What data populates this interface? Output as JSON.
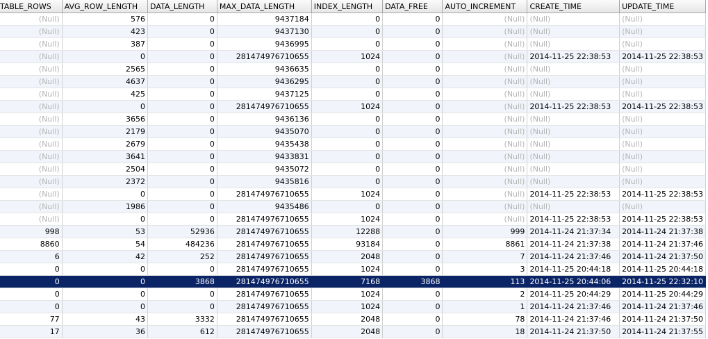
{
  "columns": [
    "TABLE_ROWS",
    "AVG_ROW_LENGTH",
    "DATA_LENGTH",
    "MAX_DATA_LENGTH",
    "INDEX_LENGTH",
    "DATA_FREE",
    "AUTO_INCREMENT",
    "CREATE_TIME",
    "UPDATE_TIME"
  ],
  "selected_row": 21,
  "rows": [
    [
      "(Null)",
      "576",
      "0",
      "9437184",
      "0",
      "0",
      "(Null)",
      "(Null)",
      "(Null)"
    ],
    [
      "(Null)",
      "423",
      "0",
      "9437130",
      "0",
      "0",
      "(Null)",
      "(Null)",
      "(Null)"
    ],
    [
      "(Null)",
      "387",
      "0",
      "9436995",
      "0",
      "0",
      "(Null)",
      "(Null)",
      "(Null)"
    ],
    [
      "(Null)",
      "0",
      "0",
      "281474976710655",
      "1024",
      "0",
      "(Null)",
      "2014-11-25 22:38:53",
      "2014-11-25 22:38:53"
    ],
    [
      "(Null)",
      "2565",
      "0",
      "9436635",
      "0",
      "0",
      "(Null)",
      "(Null)",
      "(Null)"
    ],
    [
      "(Null)",
      "4637",
      "0",
      "9436295",
      "0",
      "0",
      "(Null)",
      "(Null)",
      "(Null)"
    ],
    [
      "(Null)",
      "425",
      "0",
      "9437125",
      "0",
      "0",
      "(Null)",
      "(Null)",
      "(Null)"
    ],
    [
      "(Null)",
      "0",
      "0",
      "281474976710655",
      "1024",
      "0",
      "(Null)",
      "2014-11-25 22:38:53",
      "2014-11-25 22:38:53"
    ],
    [
      "(Null)",
      "3656",
      "0",
      "9436136",
      "0",
      "0",
      "(Null)",
      "(Null)",
      "(Null)"
    ],
    [
      "(Null)",
      "2179",
      "0",
      "9435070",
      "0",
      "0",
      "(Null)",
      "(Null)",
      "(Null)"
    ],
    [
      "(Null)",
      "2679",
      "0",
      "9435438",
      "0",
      "0",
      "(Null)",
      "(Null)",
      "(Null)"
    ],
    [
      "(Null)",
      "3641",
      "0",
      "9433831",
      "0",
      "0",
      "(Null)",
      "(Null)",
      "(Null)"
    ],
    [
      "(Null)",
      "2504",
      "0",
      "9435072",
      "0",
      "0",
      "(Null)",
      "(Null)",
      "(Null)"
    ],
    [
      "(Null)",
      "2372",
      "0",
      "9435816",
      "0",
      "0",
      "(Null)",
      "(Null)",
      "(Null)"
    ],
    [
      "(Null)",
      "0",
      "0",
      "281474976710655",
      "1024",
      "0",
      "(Null)",
      "2014-11-25 22:38:53",
      "2014-11-25 22:38:53"
    ],
    [
      "(Null)",
      "1986",
      "0",
      "9435486",
      "0",
      "0",
      "(Null)",
      "(Null)",
      "(Null)"
    ],
    [
      "(Null)",
      "0",
      "0",
      "281474976710655",
      "1024",
      "0",
      "(Null)",
      "2014-11-25 22:38:53",
      "2014-11-25 22:38:53"
    ],
    [
      "998",
      "53",
      "52936",
      "281474976710655",
      "12288",
      "0",
      "999",
      "2014-11-24 21:37:34",
      "2014-11-24 21:37:38"
    ],
    [
      "8860",
      "54",
      "484236",
      "281474976710655",
      "93184",
      "0",
      "8861",
      "2014-11-24 21:37:38",
      "2014-11-24 21:37:46"
    ],
    [
      "6",
      "42",
      "252",
      "281474976710655",
      "2048",
      "0",
      "7",
      "2014-11-24 21:37:46",
      "2014-11-24 21:37:50"
    ],
    [
      "0",
      "0",
      "0",
      "281474976710655",
      "1024",
      "0",
      "3",
      "2014-11-25 20:44:18",
      "2014-11-25 20:44:18"
    ],
    [
      "0",
      "0",
      "3868",
      "281474976710655",
      "7168",
      "3868",
      "113",
      "2014-11-25 20:44:06",
      "2014-11-25 22:32:10"
    ],
    [
      "0",
      "0",
      "0",
      "281474976710655",
      "1024",
      "0",
      "2",
      "2014-11-25 20:44:29",
      "2014-11-25 20:44:29"
    ],
    [
      "0",
      "0",
      "0",
      "281474976710655",
      "1024",
      "0",
      "1",
      "2014-11-24 21:37:46",
      "2014-11-24 21:37:46"
    ],
    [
      "77",
      "43",
      "3332",
      "281474976710655",
      "2048",
      "0",
      "78",
      "2014-11-24 21:37:46",
      "2014-11-24 21:37:50"
    ],
    [
      "17",
      "36",
      "612",
      "281474976710655",
      "2048",
      "0",
      "18",
      "2014-11-24 21:37:50",
      "2014-11-24 21:37:55"
    ]
  ]
}
